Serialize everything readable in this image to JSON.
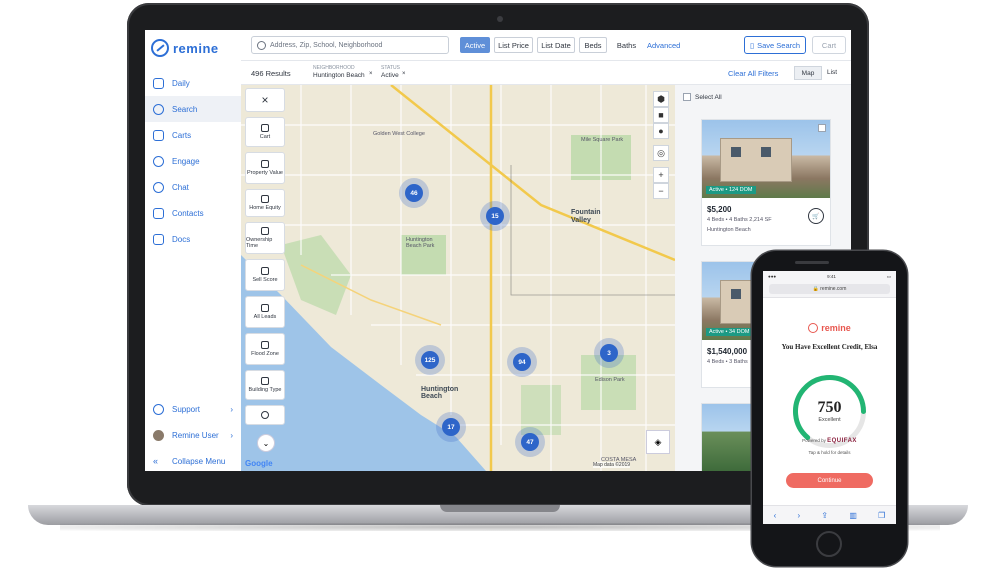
{
  "app": {
    "logo_text": "remine",
    "brand_color": "#2d6fd6"
  },
  "sidebar": {
    "items": [
      {
        "label": "Daily",
        "icon": "coffee-icon"
      },
      {
        "label": "Search",
        "icon": "search-icon",
        "active": true
      },
      {
        "label": "Carts",
        "icon": "cart-icon"
      },
      {
        "label": "Engage",
        "icon": "people-icon"
      },
      {
        "label": "Chat",
        "icon": "chat-icon"
      },
      {
        "label": "Contacts",
        "icon": "contacts-icon"
      },
      {
        "label": "Docs",
        "icon": "docs-icon"
      }
    ],
    "bottom": [
      {
        "label": "Support",
        "icon": "headset-icon"
      },
      {
        "label": "Remine User",
        "icon": "avatar-icon"
      },
      {
        "label": "Collapse Menu",
        "icon": "collapse-icon"
      }
    ]
  },
  "topbar": {
    "search_placeholder": "Address, Zip, School, Neighborhood",
    "chips": [
      "Active",
      "List Price",
      "List Date",
      "Beds",
      "Baths"
    ],
    "advanced": "Advanced",
    "save_search": "Save Search",
    "cart": "Cart"
  },
  "filterbar": {
    "results": "496 Results",
    "neighborhood_label": "NEIGHBORHOOD",
    "neighborhood_value": "Huntington Beach",
    "status_label": "STATUS",
    "status_value": "Active",
    "clear_all": "Clear All Filters",
    "map": "Map",
    "list": "List"
  },
  "map": {
    "clusters": [
      "46",
      "15",
      "125",
      "94",
      "3",
      "17",
      "47"
    ],
    "labels": [
      "Golden West College",
      "Mile Square Park",
      "Fountain Valley",
      "Huntington Beach Park",
      "Huntington Beach",
      "Edison Park",
      "COSTA MESA"
    ],
    "tools": [
      "Cart",
      "Property Value",
      "Home Equity",
      "Ownership Time",
      "Sell Score",
      "All Leads",
      "Flood Zone",
      "Building Type"
    ],
    "google": "Google",
    "copyright": "Map data ©2019"
  },
  "list": {
    "select_all": "Select All",
    "cards": [
      {
        "badge": "Active • 124 DOM",
        "price": "$5,200",
        "details": "4 Beds • 4 Baths 2,214 SF",
        "address": "Huntington Beach"
      },
      {
        "badge": "Active • 34 DOM",
        "price": "$1,540,000",
        "details": "4 Beds • 3 Baths",
        "address": ""
      }
    ]
  },
  "phone": {
    "time": "9:41",
    "url": "remine.com",
    "logo_text": "remine",
    "headline": "You Have Excellent Credit, Elsa",
    "score": "750",
    "score_label": "Excellent",
    "powered_by": "Powered by",
    "bureau": "EQUIFAX",
    "note": "Tap & hold for details",
    "continue": "Continue",
    "gauge_fraction": 0.82,
    "accent": "#ef6b62",
    "gauge_color": "#22b573"
  }
}
